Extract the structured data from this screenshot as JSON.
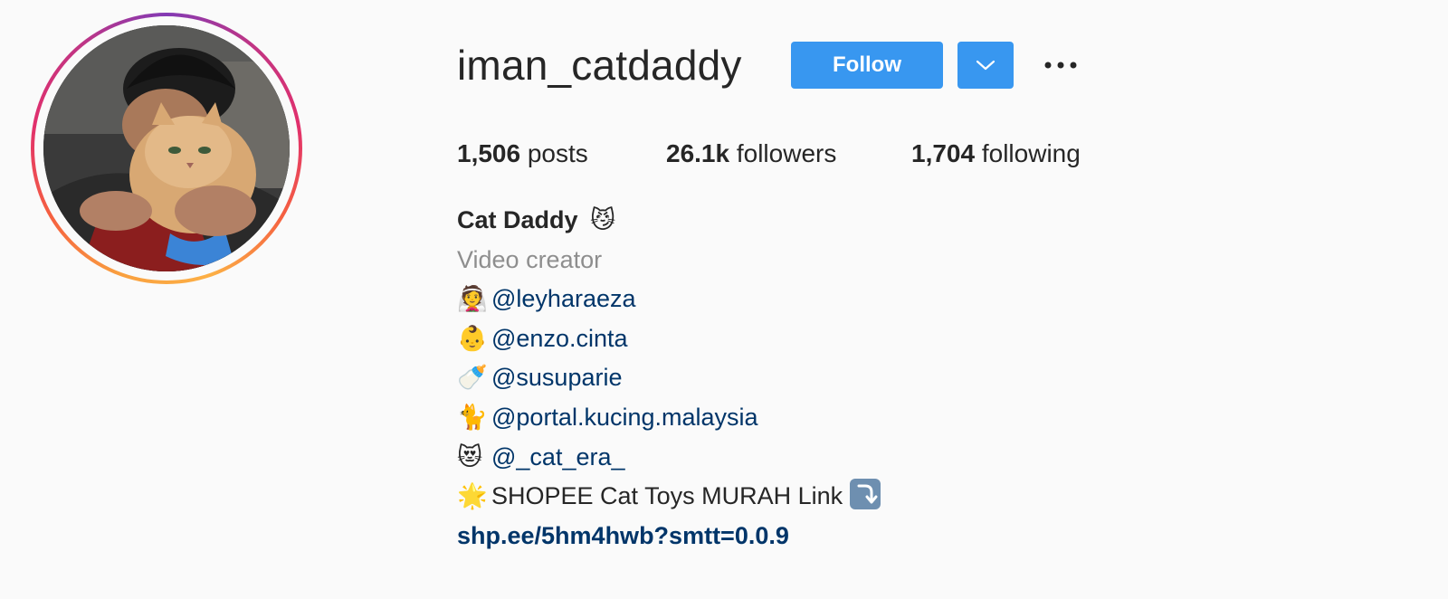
{
  "profile": {
    "username": "iman_catdaddy",
    "follow_label": "Follow",
    "dropdown_icon": "chevron-down-icon",
    "more_icon": "more-options-icon",
    "accent_color": "#3897f0"
  },
  "stats": {
    "posts_count": "1,506",
    "posts_label": " posts",
    "followers_count": "26.1k",
    "followers_label": " followers",
    "following_count": "1,704",
    "following_label": " following"
  },
  "bio": {
    "full_name": "Cat Daddy",
    "full_name_emoji": "😼",
    "category": "Video creator",
    "lines": [
      {
        "emoji": "👰",
        "text": "@leyharaeza"
      },
      {
        "emoji": "👶",
        "text": "@enzo.cinta"
      },
      {
        "emoji": "🍼",
        "text": "@susuparie"
      },
      {
        "emoji": "🐈",
        "text": "@portal.kucing.malaysia"
      },
      {
        "emoji": "😻",
        "text": "@_cat_era_"
      },
      {
        "emoji": "🌟",
        "text": "SHOPEE Cat Toys MURAH Link"
      }
    ],
    "link": "shp.ee/5hm4hwb?smtt=0.0.9"
  }
}
